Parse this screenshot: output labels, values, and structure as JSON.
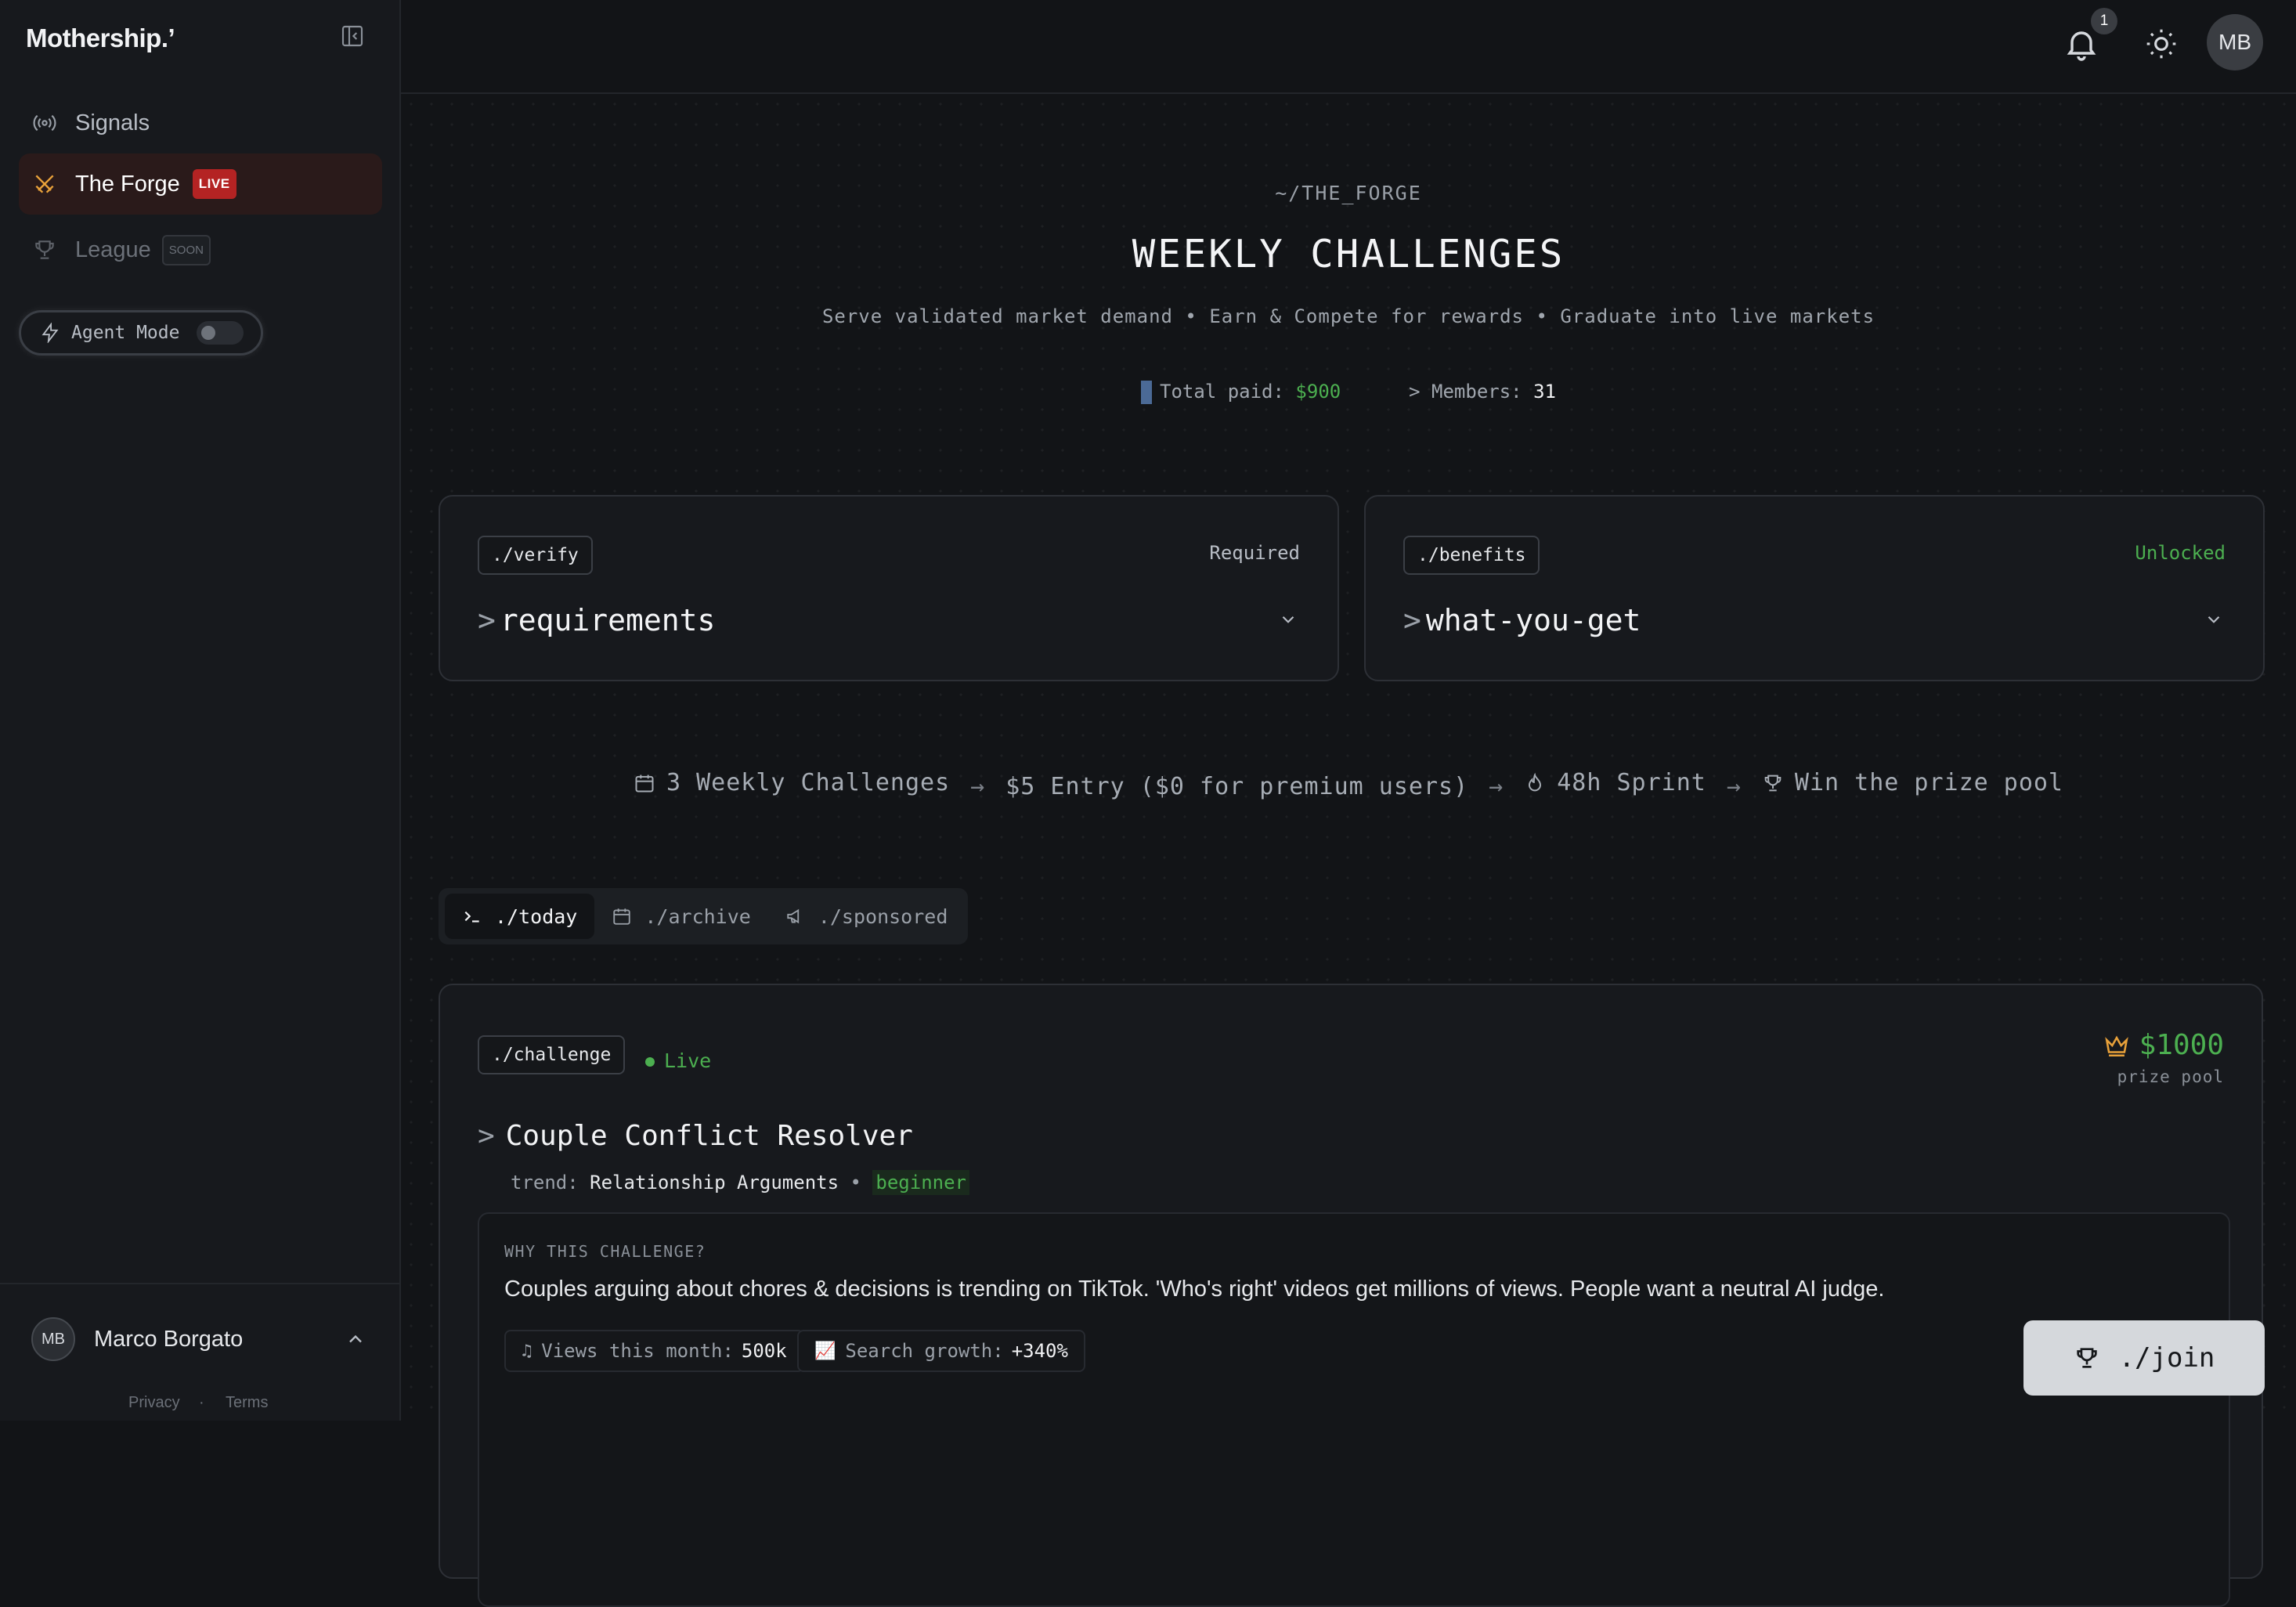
{
  "sidebar": {
    "logo": "Mothership.’",
    "nav": {
      "signals": "Signals",
      "forge": "The Forge",
      "forge_badge": "LIVE",
      "league": "League",
      "league_badge": "SOON"
    },
    "agent_mode": "Agent Mode",
    "user_initials": "MB",
    "user_name": "Marco Borgato",
    "privacy": "Privacy",
    "separator": "·",
    "terms": "Terms"
  },
  "topbar": {
    "notification_count": "1",
    "avatar_initials": "MB"
  },
  "hero": {
    "path": "~/THE_FORGE",
    "title": "WEEKLY CHALLENGES",
    "subtitle": "Serve validated market demand • Earn & Compete for rewards • Graduate into live markets",
    "total_paid_label": "Total paid:",
    "total_paid_value": "$900",
    "members_label": "> Members:",
    "members_value": "31"
  },
  "verify_card": {
    "tag": "./verify",
    "status": "Required",
    "title": "requirements"
  },
  "benefits_card": {
    "tag": "./benefits",
    "status": "Unlocked",
    "title": "what-you-get"
  },
  "flow": {
    "step1": "3 Weekly Challenges",
    "step2": "$5 Entry ($0 for premium users)",
    "step3": "48h Sprint",
    "step4": "Win the prize pool",
    "arrow": "→"
  },
  "tabs": {
    "today": "./today",
    "archive": "./archive",
    "sponsored": "./sponsored"
  },
  "challenge": {
    "tag": "./challenge",
    "status": "Live",
    "prize": "$1000",
    "prize_label": "prize pool",
    "title": "Couple Conflict Resolver",
    "trend_label": "trend:",
    "trend_value": "Relationship Arguments",
    "level": "beginner",
    "why_label": "WHY THIS CHALLENGE?",
    "why_text": "Couples arguing about chores & decisions is trending on TikTok. 'Who's right' videos get millions of views. People want a neutral AI judge.",
    "metric1_label": "Views this month:",
    "metric1_value": "500k",
    "metric2_label": "Search growth:",
    "metric2_value": "+340%"
  },
  "join_button": "./join",
  "colors": {
    "background": "#121417",
    "sidebar": "#17191d",
    "accent_green": "#4caf50",
    "live_badge": "#b42323",
    "forge_accent": "#e8a13a"
  }
}
